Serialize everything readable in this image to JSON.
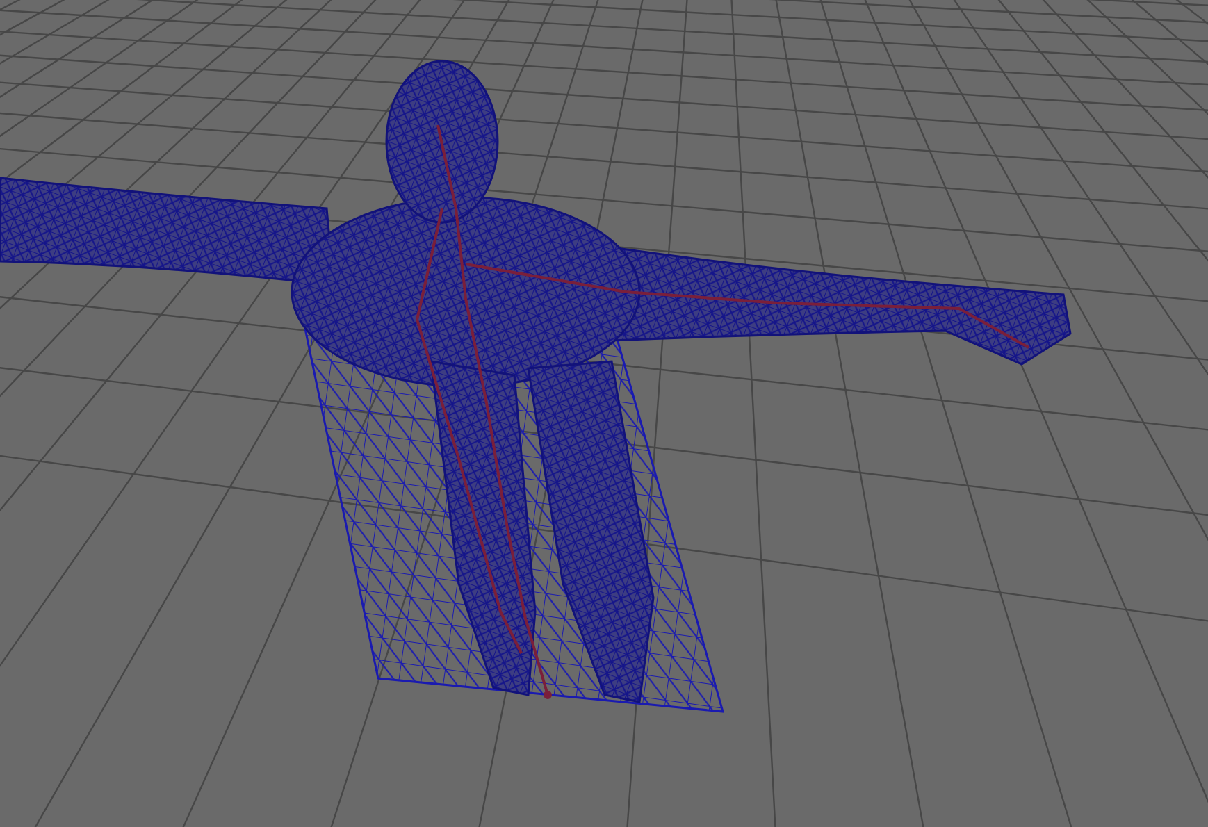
{
  "viewport": {
    "show_grid": true,
    "show_skeleton": true,
    "wireframe": true
  }
}
